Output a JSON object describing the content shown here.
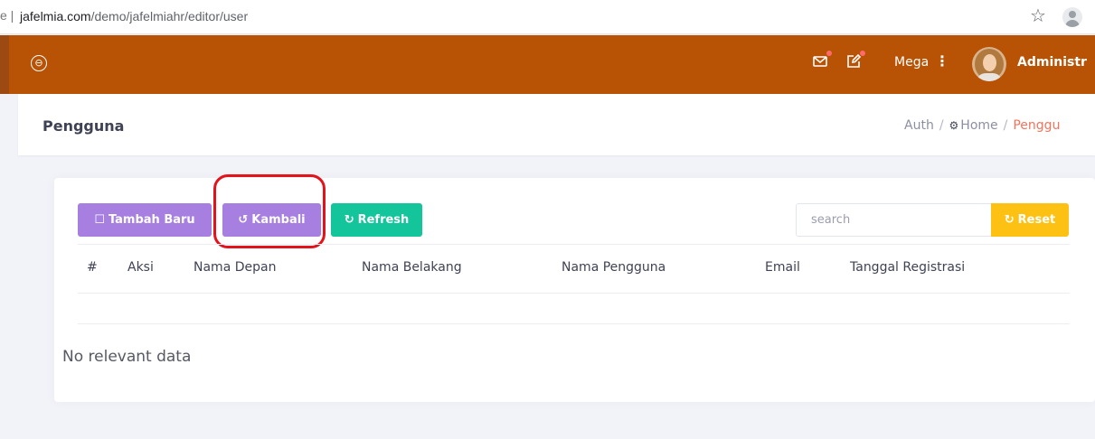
{
  "browser": {
    "url_prefix": "e |",
    "url_host": "jafelmia.com",
    "url_path": "/demo/jafelmiahr/editor/user",
    "star_glyph": "☆"
  },
  "topbar": {
    "collapse_glyph": "⊖",
    "user_name": "Mega",
    "menu_glyph": "⋮",
    "admin_label": "Administr",
    "colors": {
      "background": "#b85205",
      "badge": "#ff6b6b"
    }
  },
  "page_header": {
    "title": "Pengguna",
    "breadcrumb": [
      "Auth",
      "Home",
      "Penggu"
    ]
  },
  "toolbar": {
    "tambah_baru": "Tambah Baru",
    "kambali": "Kambali",
    "refresh": "Refresh",
    "reset": "Reset",
    "search_placeholder": "search",
    "colors": {
      "purple": "#a67fe0",
      "green": "#14c49a",
      "yellow": "#fdc113",
      "highlight": "#e3131b"
    }
  },
  "table": {
    "columns": [
      "#",
      "Aksi",
      "Nama Depan",
      "Nama Belakang",
      "Nama Pengguna",
      "Email",
      "Tanggal Registrasi"
    ],
    "rows": [],
    "empty_message": "No relevant data"
  }
}
